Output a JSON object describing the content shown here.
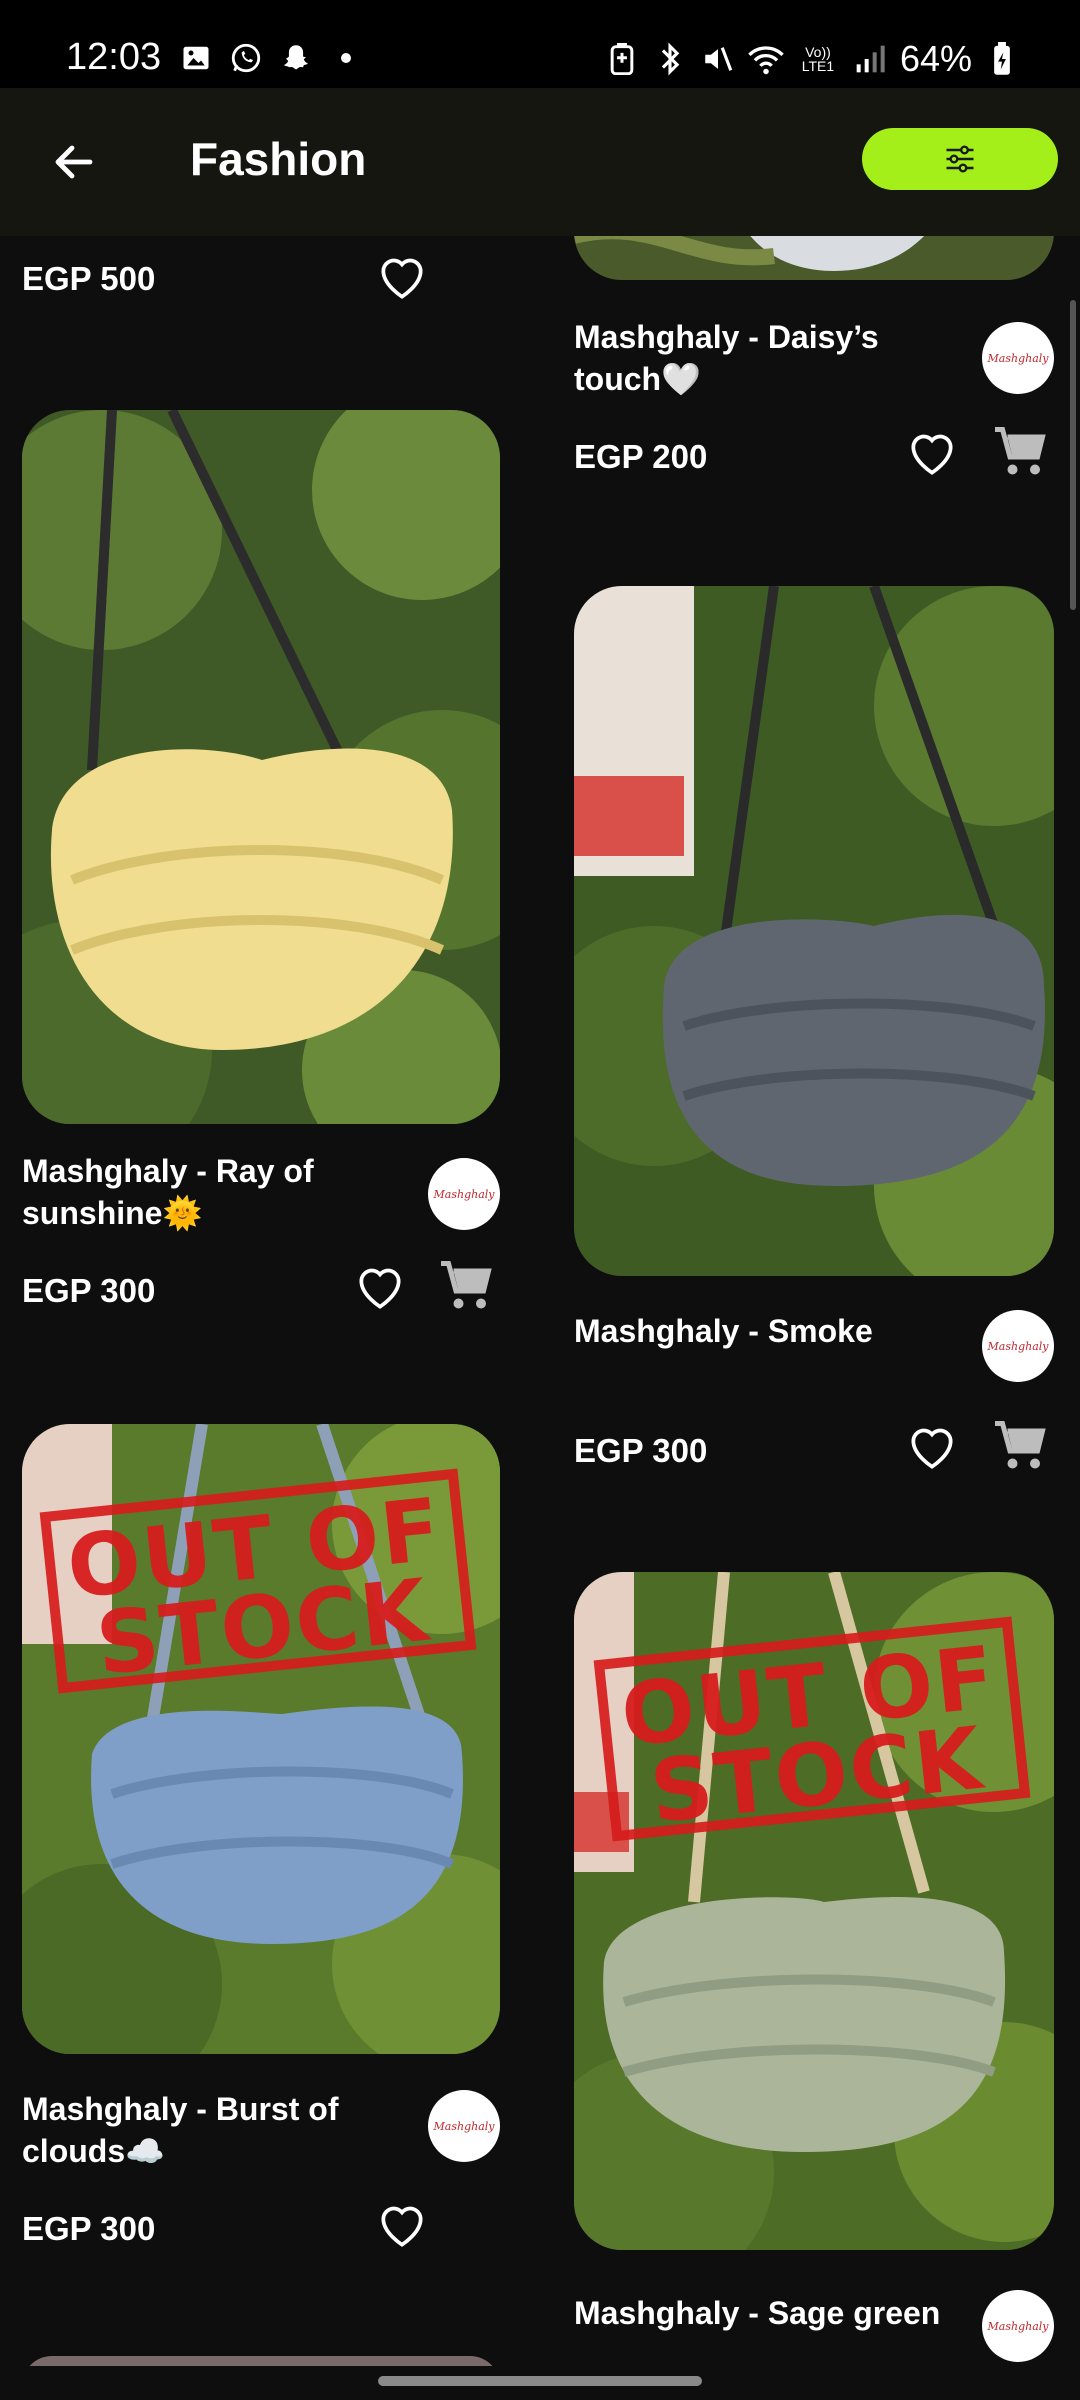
{
  "status_bar": {
    "time": "12:03",
    "battery": "64%",
    "icons_left": [
      "gallery-icon",
      "whatsapp-icon",
      "snapchat-icon",
      "dot-icon"
    ],
    "icons_right": [
      "battery-saver-icon",
      "bluetooth-icon",
      "mute-icon",
      "wifi-icon",
      "volte-icon",
      "signal-icon",
      "battery-icon"
    ],
    "network_label": "Vo)) LTE1"
  },
  "app_bar": {
    "title": "Fashion",
    "back_icon": "back-arrow-icon",
    "filter_icon": "sliders-icon",
    "accent_color": "#a4ee1a"
  },
  "stamp_text": [
    "OUT OF",
    "STOCK"
  ],
  "seller_logo_text": "Mashghaly",
  "currency": "EGP",
  "products": [
    {
      "id": "p1",
      "title": "",
      "price": "EGP 500",
      "has_cart": false,
      "out_of_stock": false
    },
    {
      "id": "p2",
      "title": "Mashghaly - Daisy’s touch🤍",
      "price": "EGP 200",
      "has_cart": true,
      "out_of_stock": false
    },
    {
      "id": "p3",
      "title": "Mashghaly - Ray of sunshine🌞",
      "price": "EGP 300",
      "has_cart": true,
      "out_of_stock": false,
      "bag_color": "#f1dd8f"
    },
    {
      "id": "p4",
      "title": "Mashghaly - Smoke",
      "price": "EGP 300",
      "has_cart": true,
      "out_of_stock": false,
      "bag_color": "#5f6670"
    },
    {
      "id": "p5",
      "title": "Mashghaly - Burst of clouds☁️",
      "price": "EGP 300",
      "has_cart": false,
      "out_of_stock": true,
      "bag_color": "#7f9fc8"
    },
    {
      "id": "p6",
      "title": "Mashghaly - Sage green",
      "price": "",
      "has_cart": false,
      "out_of_stock": true,
      "bag_color": "#aab59a"
    }
  ]
}
